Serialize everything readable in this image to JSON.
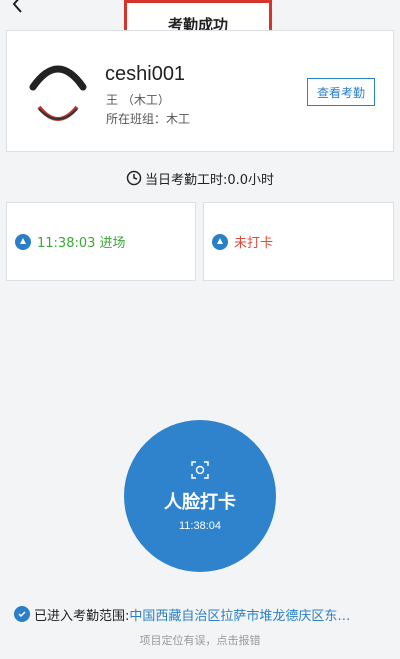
{
  "toast": {
    "text": "考勤成功"
  },
  "profile": {
    "name": "ceshi001",
    "subtitle": "王 （木工）",
    "team": "所在班组：木工",
    "view_button": "查看考勤"
  },
  "hours": {
    "text": "当日考勤工时:0.0小时"
  },
  "punch": {
    "in_text": "11:38:03 进场",
    "out_text": "未打卡"
  },
  "face_button": {
    "label": "人脸打卡",
    "time": "11:38:04"
  },
  "location": {
    "label": "已进入考勤范围:",
    "value": "中国西藏自治区拉萨市堆龙德庆区东…",
    "report": "项目定位有误，点击报错"
  },
  "colors": {
    "accent": "#2f82cc",
    "success": "#3aaa35",
    "danger": "#e04a3a",
    "highlight_border": "#d6332a"
  },
  "icons": {
    "back": "chevron-left-icon",
    "clock": "clock-icon",
    "pin": "location-pin-icon",
    "face": "face-scan-icon",
    "check": "check-circle-icon"
  }
}
